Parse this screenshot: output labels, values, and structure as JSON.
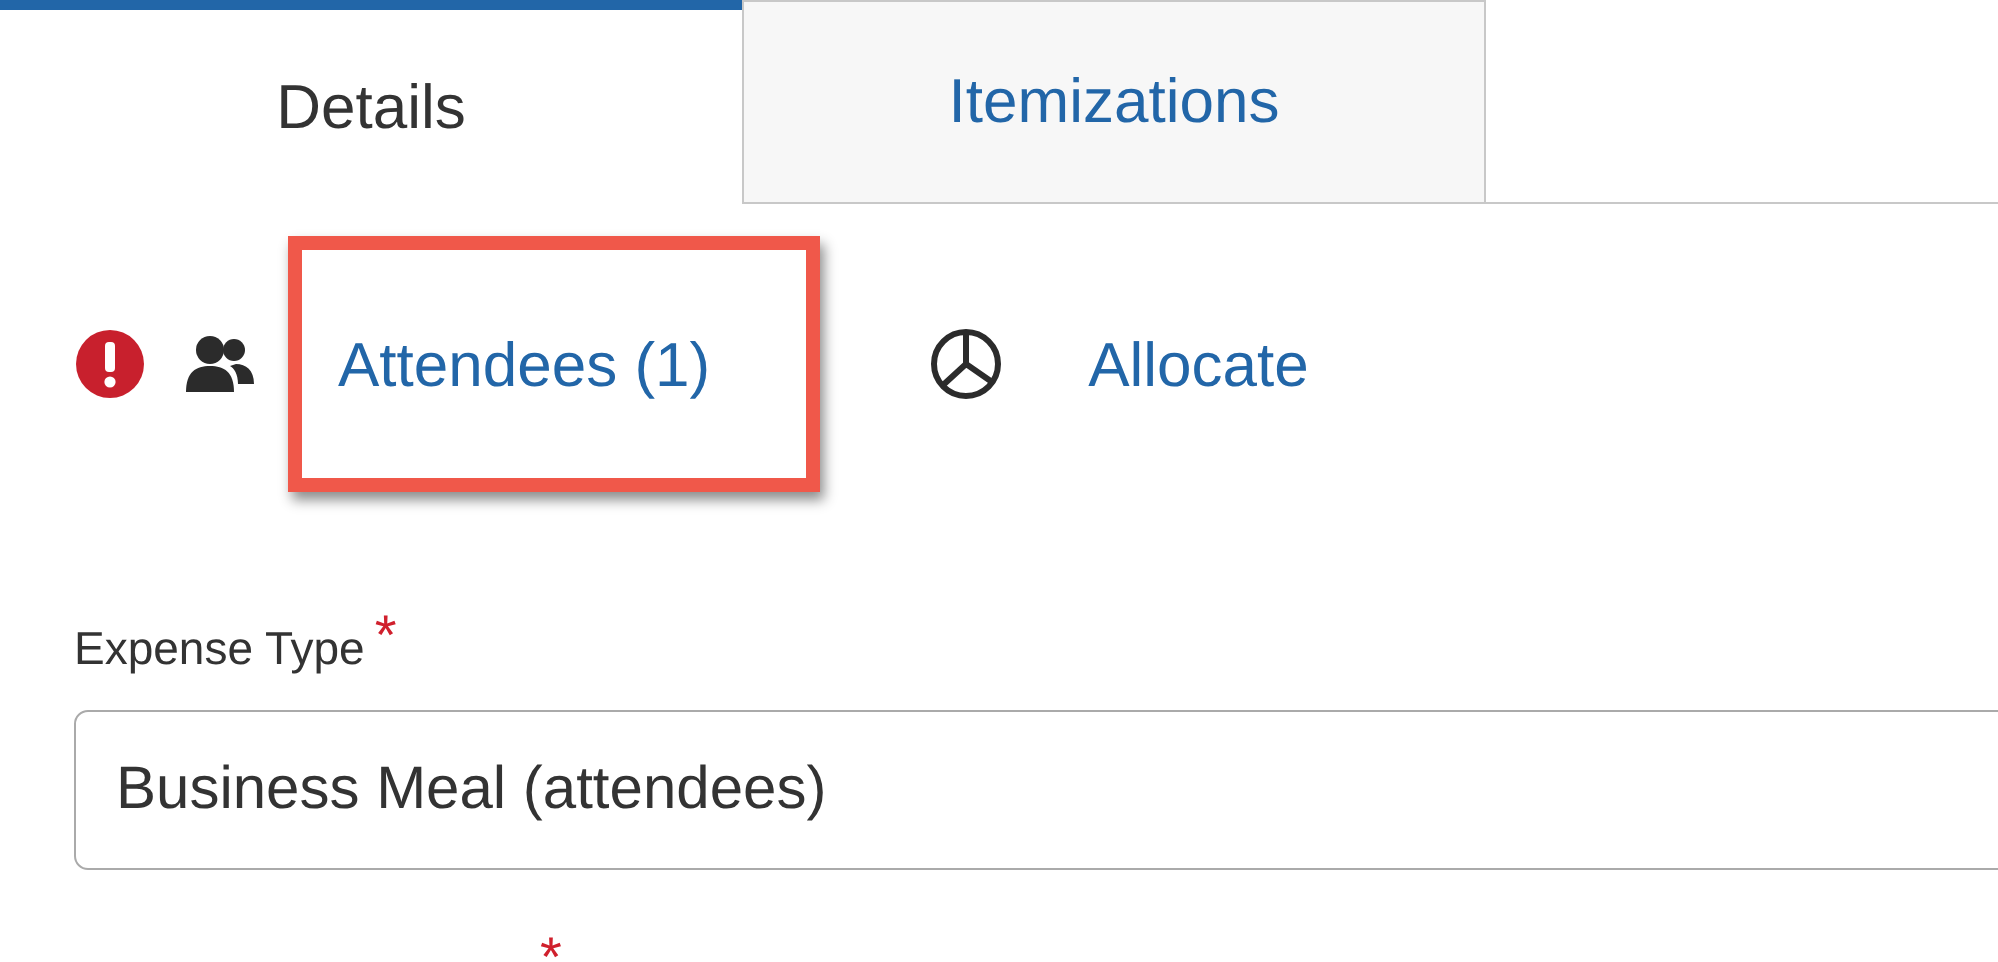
{
  "tabs": [
    {
      "label": "Details",
      "selected": true
    },
    {
      "label": "Itemizations",
      "selected": false
    }
  ],
  "actions": [
    {
      "kind": "attendees",
      "label": "Attendees (1)",
      "error": true,
      "highlighted": true
    },
    {
      "kind": "allocate",
      "label": "Allocate",
      "error": false,
      "highlighted": false
    }
  ],
  "fields": [
    {
      "label": "Expense Type",
      "required_mark": "*",
      "value": "Business Meal (attendees)"
    },
    {
      "required_mark": "*"
    }
  ]
}
